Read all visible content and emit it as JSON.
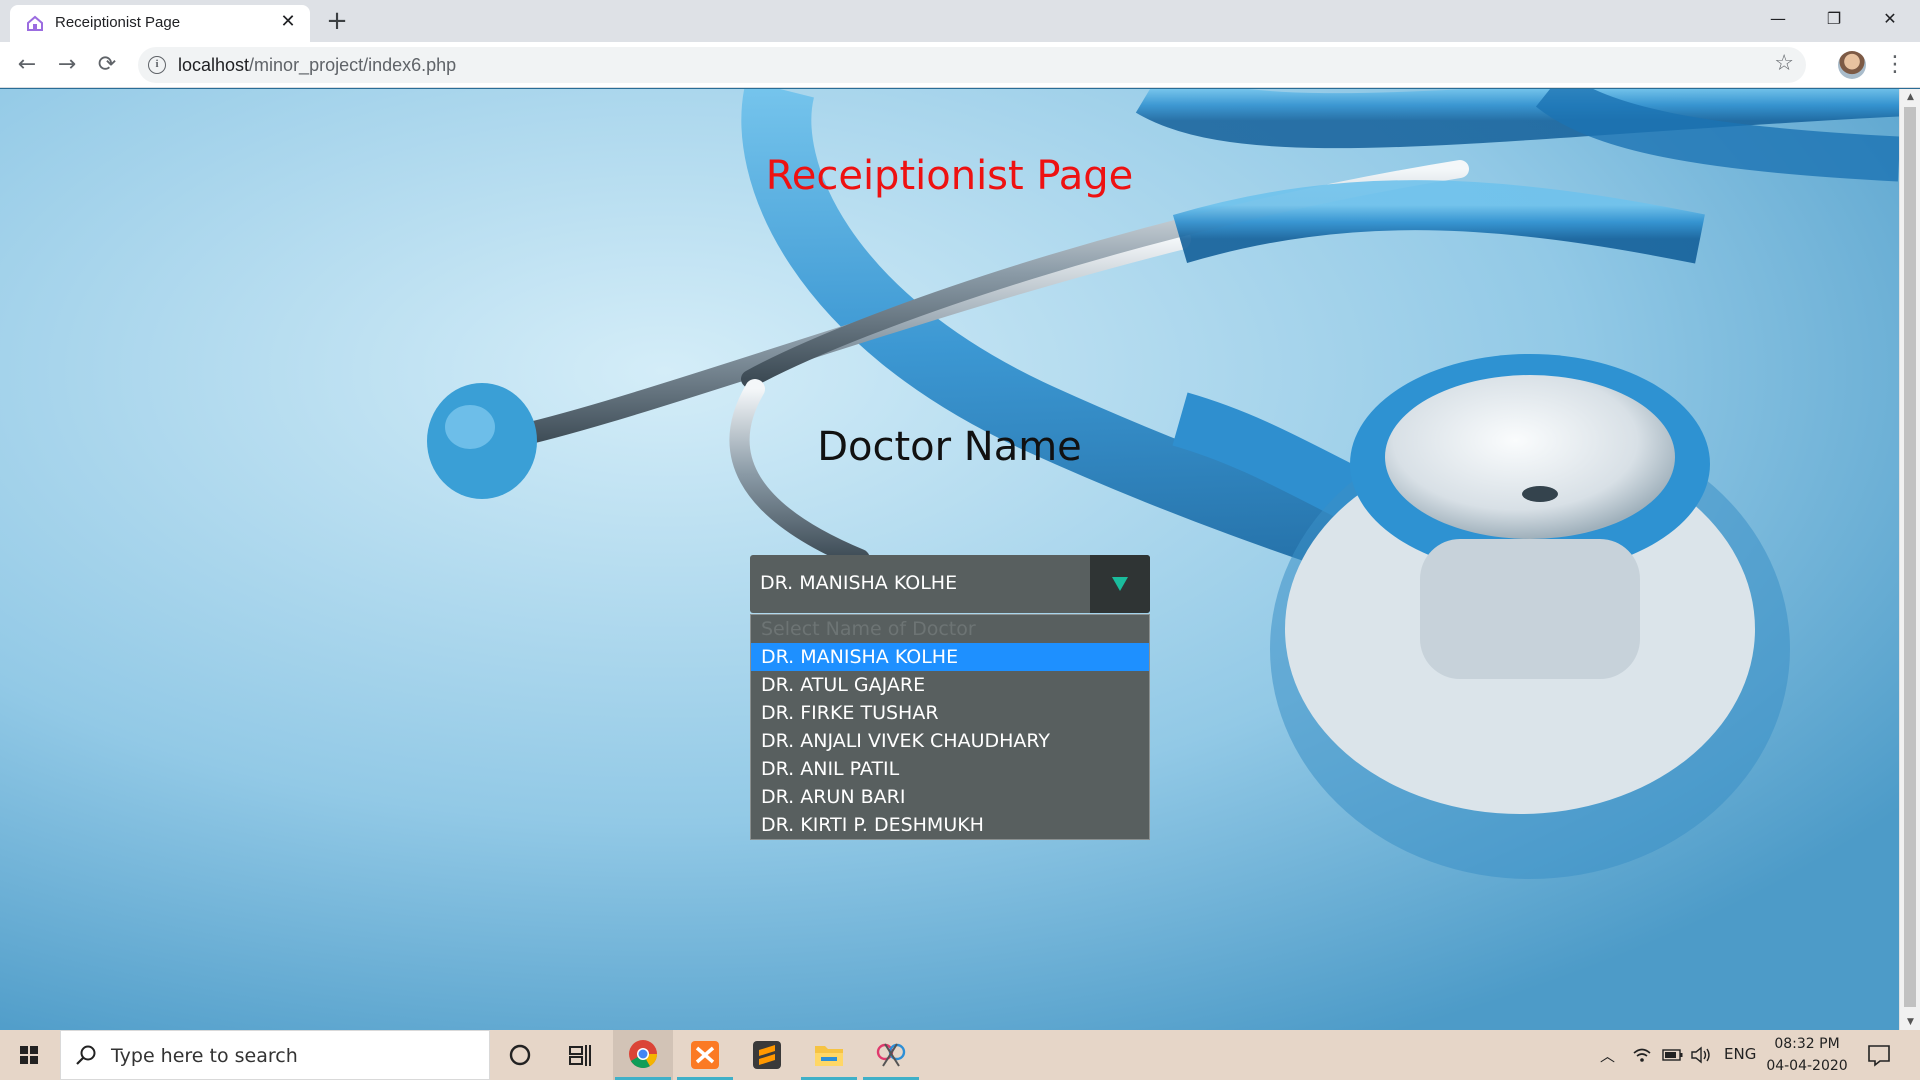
{
  "browser": {
    "tab_title": "Receiptionist Page",
    "tab_close": "✕",
    "new_tab": "+",
    "url_host": "localhost",
    "url_path": "/minor_project/index6.php",
    "window_controls": {
      "minimize": "—",
      "maximize": "❐",
      "close": "✕"
    },
    "nav": {
      "back": "←",
      "forward": "→",
      "reload": "⟳"
    }
  },
  "page": {
    "title": "Receiptionist Page",
    "title_color": "#ee1111",
    "doctor_label": "Doctor Name",
    "select": {
      "selected": "DR. MANISHA KOLHE",
      "placeholder": "Select Name of Doctor",
      "options": [
        "DR. MANISHA KOLHE",
        "DR. ATUL GAJARE",
        "DR. FIRKE TUSHAR",
        "DR. ANJALI VIVEK CHAUDHARY",
        "DR. ANIL PATIL",
        "DR. ARUN BARI",
        "DR. KIRTI P. DESHMUKH"
      ],
      "arrow_color": "#1abc9c",
      "highlight_color": "#1e90ff"
    }
  },
  "taskbar": {
    "search_placeholder": "Type here to search",
    "apps": [
      "cortana-icon",
      "task-view-icon",
      "chrome-icon",
      "xampp-icon",
      "sublime-text-icon",
      "file-explorer-icon",
      "snipping-tool-icon"
    ],
    "language": "ENG",
    "time": "08:32 PM",
    "date": "04-04-2020"
  }
}
